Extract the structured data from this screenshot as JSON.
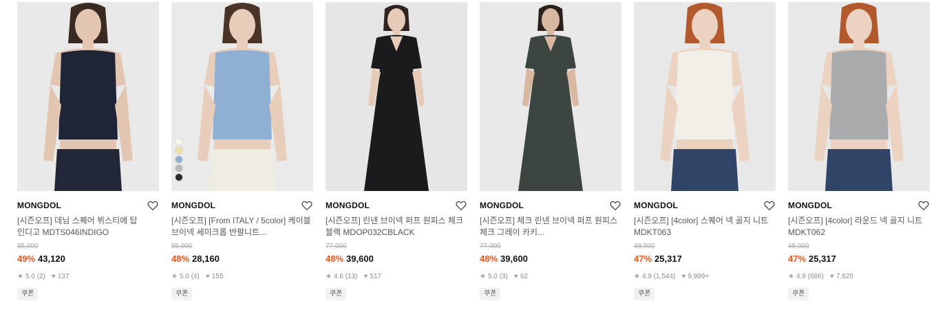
{
  "products": [
    {
      "brand": "MONGDOL",
      "name": "[시즌오프] 데님 스퀘어 뷔스티에 탑 인디고 MDTS046INDIGO",
      "original_price": "85,000",
      "discount": "49%",
      "price": "43,120",
      "rating": "5.0",
      "review_count": "(2)",
      "likes": "137",
      "badge": "쿠폰",
      "image_icon": "denim-bustier-top-photo",
      "colors": {
        "bg": "#e9e9e9",
        "top": "#1f2436",
        "skin": "#e3c6b2",
        "hair": "#3a2a22",
        "bottom": "#232838"
      }
    },
    {
      "brand": "MONGDOL",
      "name": "[시즌오프] [From ITALY / 5color] 케이블 브이넥 세미크롭 반팔니트...",
      "original_price": "55,000",
      "discount": "48%",
      "price": "28,160",
      "rating": "5.0",
      "review_count": "(4)",
      "likes": "155",
      "badge": "쿠폰",
      "image_icon": "cable-knit-top-photo",
      "colors": {
        "bg": "#eaeaea",
        "top": "#8fb0d2",
        "skin": "#e8cdbb",
        "hair": "#4a3428",
        "bottom": "#efece4"
      },
      "swatches": [
        "#f6f4ea",
        "#efe2a8",
        "#8fb0d2",
        "#b8b8b8",
        "#2a2a2a"
      ]
    },
    {
      "brand": "MONGDOL",
      "name": "[시즌오프] 린넨 브이넥 퍼프 원피스 체크 블랙 MDOP032CBLACK",
      "original_price": "77,000",
      "discount": "48%",
      "price": "39,600",
      "rating": "4.6",
      "review_count": "(13)",
      "likes": "517",
      "badge": "쿠폰",
      "image_icon": "black-dress-photo",
      "colors": {
        "bg": "#e6e6e6",
        "top": "#1b1b1d",
        "skin": "#e6cbb8",
        "hair": "#2f241f",
        "bottom": "#1b1b1d"
      }
    },
    {
      "brand": "MONGDOL",
      "name": "[시즌오프] 체크 린넨 브이넥 퍼프 원피스 체크 그레이 카키...",
      "original_price": "77,000",
      "discount": "48%",
      "price": "39,600",
      "rating": "5.0",
      "review_count": "(3)",
      "likes": "62",
      "badge": "쿠폰",
      "image_icon": "check-dress-photo",
      "colors": {
        "bg": "#e9e9e9",
        "top": "#3c4540",
        "skin": "#d9b8a2",
        "hair": "#2a201c",
        "bottom": "#3c4540"
      }
    },
    {
      "brand": "MONGDOL",
      "name": "[시즌오프] [4color] 스퀘어 넥 골지 니트 MDKT063",
      "original_price": "48,000",
      "discount": "47%",
      "price": "25,317",
      "rating": "4.9",
      "review_count": "(1,544)",
      "likes": "9,999+",
      "badge": "쿠폰",
      "image_icon": "square-neck-knit-photo",
      "colors": {
        "bg": "#e8e8e8",
        "top": "#f1efe8",
        "skin": "#ecd2c0",
        "hair": "#b25a2e",
        "bottom": "#2f4466"
      }
    },
    {
      "brand": "MONGDOL",
      "name": "[시즌오프] [4color] 라운드 넥 골지 니트 MDKT062",
      "original_price": "48,000",
      "discount": "47%",
      "price": "25,317",
      "rating": "4.9",
      "review_count": "(686)",
      "likes": "7,620",
      "badge": "쿠폰",
      "image_icon": "round-neck-knit-photo",
      "colors": {
        "bg": "#e8e8e8",
        "top": "#a9abad",
        "skin": "#ecd2c0",
        "hair": "#b25a2e",
        "bottom": "#2f4466"
      }
    }
  ],
  "icons": {
    "like": "heart-outline-icon",
    "star": "star-icon",
    "likes_count": "heart-filled-icon"
  }
}
